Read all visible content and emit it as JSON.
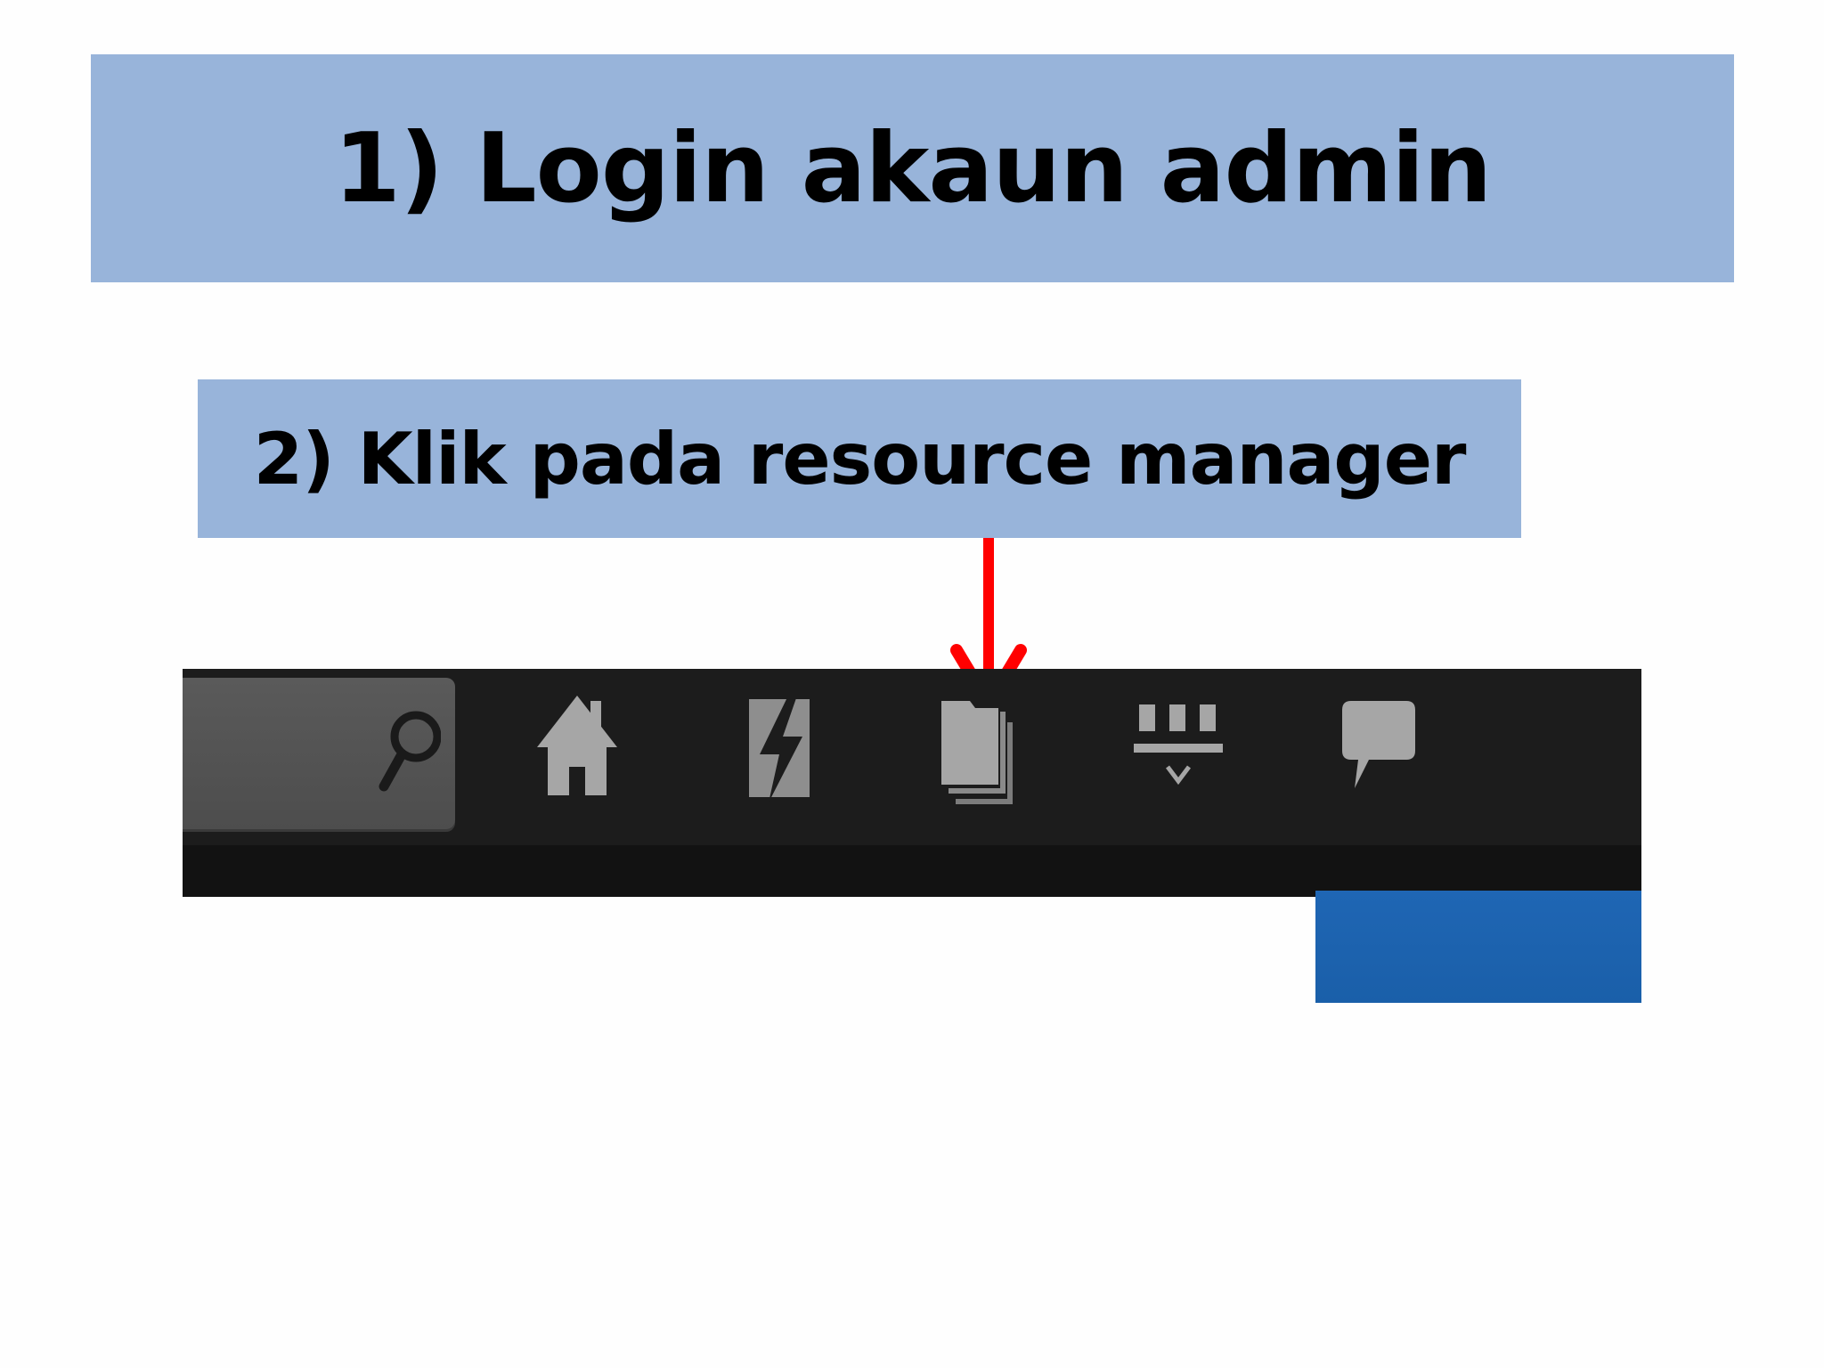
{
  "slide": {
    "step1": "1) Login akaun admin",
    "step2": "2) Klik pada resource manager"
  },
  "toolbar": {
    "icons": [
      "search-icon",
      "home-icon",
      "bolt-icon",
      "files-icon",
      "sort-icon",
      "chat-icon"
    ]
  },
  "colors": {
    "banner": "#98b4da",
    "toolbar": "#1c1c1c",
    "arrow": "#ff0000",
    "blue_panel": "#1f66b4",
    "icon": "#a6a6a6"
  }
}
